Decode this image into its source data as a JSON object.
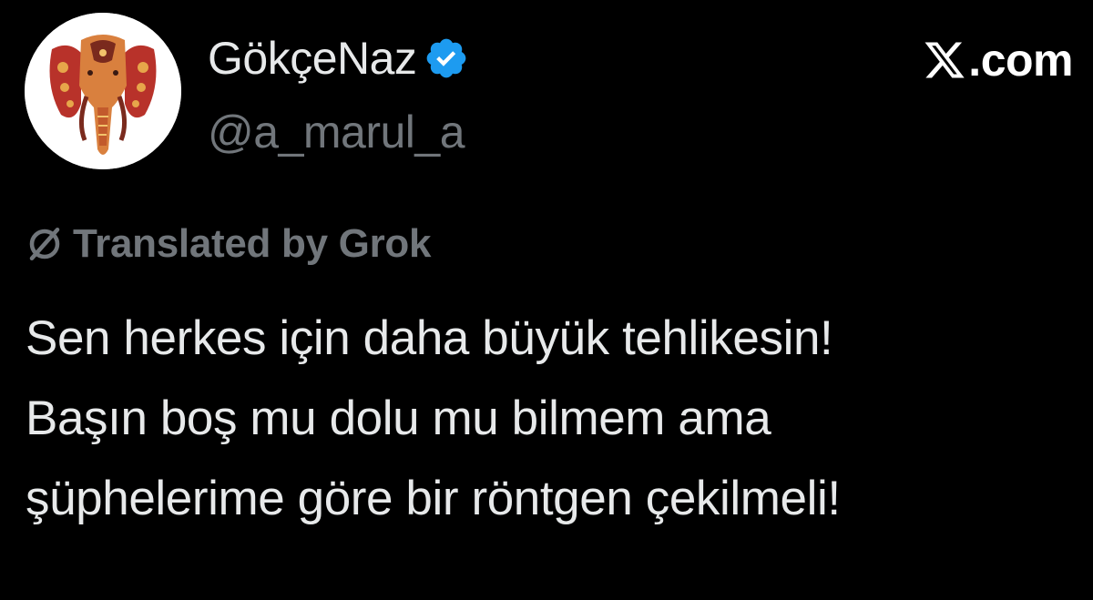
{
  "author": {
    "display_name": "GökçeNaz",
    "handle": "@a_marul_a",
    "verified": true,
    "verified_color": "#1d9bf0",
    "avatar_icon": "elephant-avatar-icon"
  },
  "brand": {
    "text": ".com",
    "icon": "x-logo-icon"
  },
  "translation": {
    "label": "Translated by Grok",
    "icon": "grok-icon"
  },
  "tweet": {
    "lines": [
      "Sen herkes için daha büyük tehlikesin!",
      "Başın boş mu dolu mu bilmem ama",
      "şüphelerime göre bir röntgen çekilmeli!"
    ]
  },
  "colors": {
    "background": "#000000",
    "primary_text": "#e7e9ea",
    "secondary_text": "#71767b",
    "accent": "#1d9bf0"
  }
}
